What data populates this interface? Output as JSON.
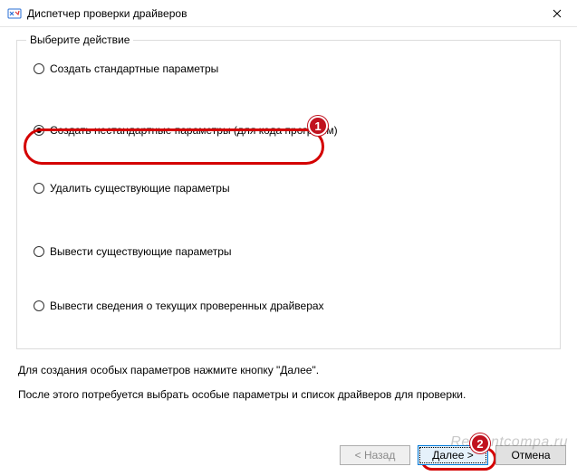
{
  "window": {
    "title": "Диспетчер проверки драйверов"
  },
  "group": {
    "legend": "Выберите действие",
    "options": [
      {
        "label": "Создать стандартные параметры",
        "selected": false
      },
      {
        "label": "Создать нестандартные параметры (для кода программ)",
        "selected": true
      },
      {
        "label": "Удалить существующие параметры",
        "selected": false
      },
      {
        "label": "Вывести существующие параметры",
        "selected": false
      },
      {
        "label": "Вывести сведения о текущих проверенных драйверах",
        "selected": false
      }
    ]
  },
  "info": {
    "line1": "Для создания особых параметров нажмите кнопку \"Далее\".",
    "line2": "После этого потребуется выбрать особые параметры и список драйверов для проверки."
  },
  "buttons": {
    "back": "< Назад",
    "next": "Далее >",
    "cancel": "Отмена"
  },
  "annotations": {
    "marker1": "1",
    "marker2": "2"
  },
  "watermark": "Remontcompa.ru"
}
